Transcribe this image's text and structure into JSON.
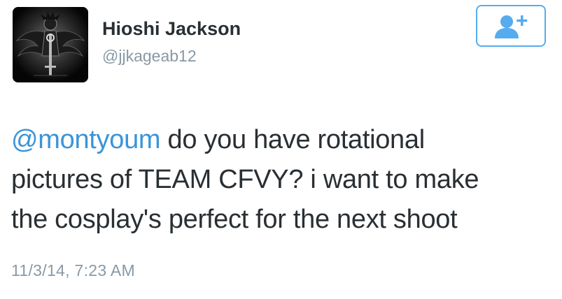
{
  "user": {
    "display_name": "Hioshi Jackson",
    "handle": "@jjkageab12",
    "avatar_icon": "avatar-image"
  },
  "follow_button": {
    "icon": "follow-user-icon",
    "color": "#55acee"
  },
  "tweet": {
    "mention": "@montyoum",
    "line1_rest": " do you have rotational",
    "line2": "pictures of TEAM CFVY? i want to make",
    "line3": "the cosplay's perfect for the next shoot",
    "timestamp": "11/3/14, 7:23 AM"
  },
  "colors": {
    "text": "#292f33",
    "muted": "#8899a6",
    "link": "#3b94d9",
    "accent": "#55acee"
  }
}
